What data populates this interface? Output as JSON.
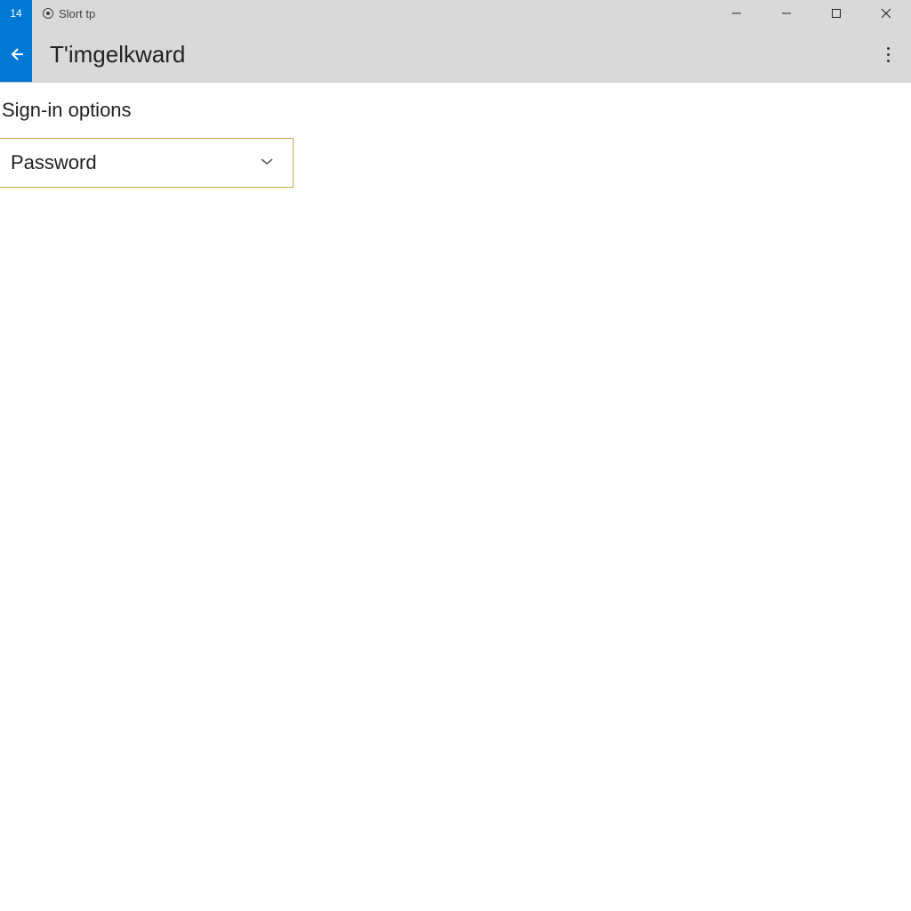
{
  "titlebar": {
    "badge": "14",
    "app_label": "Slort tp"
  },
  "header": {
    "title": "T'imgelkward"
  },
  "body": {
    "section_title": "Sign-in options",
    "dropdown": {
      "selected": "Password"
    }
  }
}
